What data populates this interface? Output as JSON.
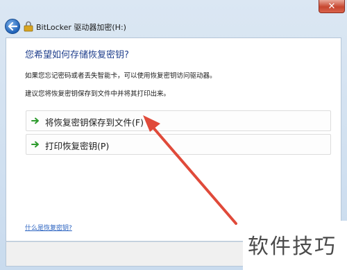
{
  "window": {
    "title": "BitLocker 驱动器加密(H:)",
    "close_glyph": "✕"
  },
  "page": {
    "heading": "您希望如何存储恢复密钥?",
    "desc1": "如果您忘记密码或者丢失智能卡，可以使用恢复密钥访问驱动器。",
    "desc2": "建议您将恢复密钥保存到文件中并将其打印出来。",
    "options": [
      {
        "label": "将恢复密钥保存到文件(F)",
        "icon": "green-arrow-icon"
      },
      {
        "label": "打印恢复密钥(P)",
        "icon": "green-arrow-icon"
      }
    ],
    "help_link": "什么是恢复密钥?"
  },
  "watermark": "软件技巧",
  "colors": {
    "heading": "#1e3e8c",
    "link": "#2a62c0",
    "annotation_arrow": "#e04a3a",
    "option_arrow": "#2e9b2e"
  }
}
